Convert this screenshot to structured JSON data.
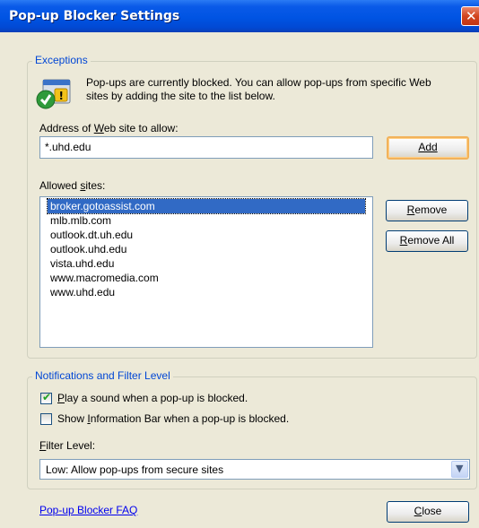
{
  "window": {
    "title": "Pop-up Blocker Settings"
  },
  "exceptions": {
    "legend": "Exceptions",
    "info_text": "Pop-ups are currently blocked.  You can allow pop-ups from specific Web sites by adding the site to the list below.",
    "address_label_pre": "Address of ",
    "address_label_key": "W",
    "address_label_post": "eb site to allow:",
    "address_value": "*.uhd.edu",
    "add_label": "Add",
    "allowed_label_pre": "Allowed ",
    "allowed_label_key": "s",
    "allowed_label_post": "ites:",
    "sites": [
      "broker.gotoassist.com",
      "mlb.mlb.com",
      "outlook.dt.uh.edu",
      "outlook.uhd.edu",
      "vista.uhd.edu",
      "www.macromedia.com",
      "www.uhd.edu"
    ],
    "selected_index": 0,
    "remove_key": "R",
    "remove_rest": "emove",
    "remove_all_key": "R",
    "remove_all_rest": "emove All"
  },
  "notifications": {
    "legend": "Notifications and Filter Level",
    "play_sound_checked": true,
    "play_sound_key": "P",
    "play_sound_rest": "lay a sound when a pop-up is blocked.",
    "info_bar_checked": false,
    "info_bar_pre": "Show ",
    "info_bar_key": "I",
    "info_bar_post": "nformation Bar when a pop-up is blocked.",
    "filter_label_key": "F",
    "filter_label_rest": "ilter Level:",
    "filter_value": "Low: Allow pop-ups from secure sites"
  },
  "footer": {
    "faq_link": "Pop-up Blocker FAQ",
    "close_key": "C",
    "close_rest": "lose"
  }
}
